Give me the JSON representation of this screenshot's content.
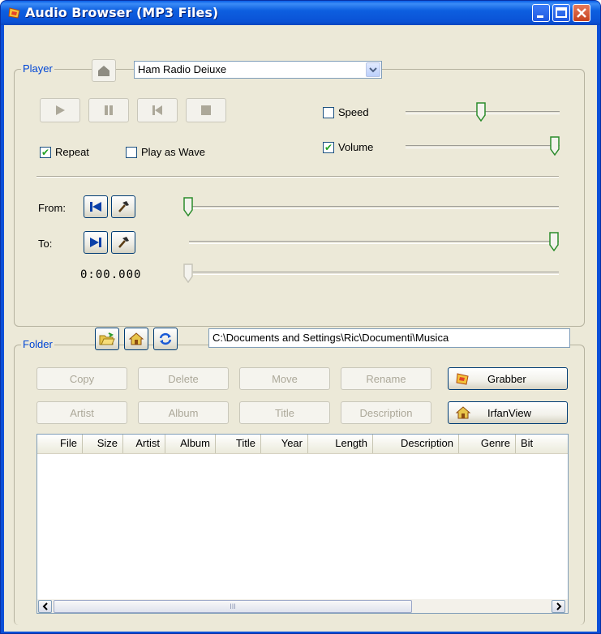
{
  "window": {
    "title": "Audio Browser (MP3 Files)",
    "app_icon": "audio-browser-app-icon",
    "controls": [
      "minimize-icon",
      "maximize-icon",
      "close-icon"
    ]
  },
  "player": {
    "legend": "Player",
    "home_icon": "home-icon",
    "station": "Ham Radio Deiuxe",
    "transport_icons": [
      "play-icon",
      "pause-icon",
      "skip-back-icon",
      "stop-icon"
    ],
    "repeat_label": "Repeat",
    "repeat_checked": true,
    "play_as_wave_label": "Play as Wave",
    "play_as_wave_checked": false,
    "speed_label": "Speed",
    "speed_checked": false,
    "speed_level": 0.5,
    "volume_label": "Volume",
    "volume_checked": true,
    "volume_level": 1.0,
    "from_label": "From:",
    "to_label": "To:",
    "from_level": 0.0,
    "to_level": 1.0,
    "position_text": "0:00.000",
    "position_level": 0.0
  },
  "folder": {
    "legend": "Folder",
    "icons": [
      "open-folder-icon",
      "home-folder-icon",
      "refresh-icon"
    ],
    "path": "C:\\Documents and Settings\\Ric\\Documenti\\Musica",
    "buttons": {
      "copy": "Copy",
      "delete": "Delete",
      "move": "Move",
      "rename": "Rename",
      "grabber": "Grabber",
      "artist": "Artist",
      "album": "Album",
      "title": "Title",
      "description": "Description",
      "irfanview": "IrfanView"
    },
    "columns": [
      "File",
      "Size",
      "Artist",
      "Album",
      "Title",
      "Year",
      "Length",
      "Description",
      "Genre",
      "Bit"
    ],
    "scroll_grip": "III"
  },
  "colors": {
    "titlebar": "#0a52d6",
    "legend_text": "#0046d5",
    "client_bg": "#ece9d8",
    "check_mark": "#21a121"
  }
}
